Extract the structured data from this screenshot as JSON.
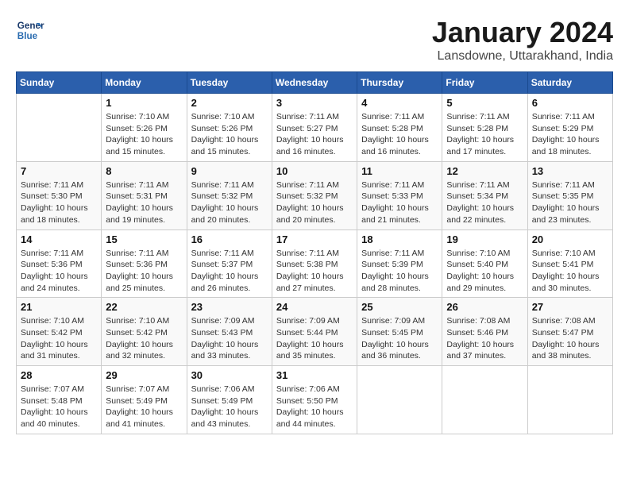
{
  "header": {
    "logo_line1": "General",
    "logo_line2": "Blue",
    "month": "January 2024",
    "location": "Lansdowne, Uttarakhand, India"
  },
  "weekdays": [
    "Sunday",
    "Monday",
    "Tuesday",
    "Wednesday",
    "Thursday",
    "Friday",
    "Saturday"
  ],
  "weeks": [
    [
      {
        "day": "",
        "info": ""
      },
      {
        "day": "1",
        "info": "Sunrise: 7:10 AM\nSunset: 5:26 PM\nDaylight: 10 hours\nand 15 minutes."
      },
      {
        "day": "2",
        "info": "Sunrise: 7:10 AM\nSunset: 5:26 PM\nDaylight: 10 hours\nand 15 minutes."
      },
      {
        "day": "3",
        "info": "Sunrise: 7:11 AM\nSunset: 5:27 PM\nDaylight: 10 hours\nand 16 minutes."
      },
      {
        "day": "4",
        "info": "Sunrise: 7:11 AM\nSunset: 5:28 PM\nDaylight: 10 hours\nand 16 minutes."
      },
      {
        "day": "5",
        "info": "Sunrise: 7:11 AM\nSunset: 5:28 PM\nDaylight: 10 hours\nand 17 minutes."
      },
      {
        "day": "6",
        "info": "Sunrise: 7:11 AM\nSunset: 5:29 PM\nDaylight: 10 hours\nand 18 minutes."
      }
    ],
    [
      {
        "day": "7",
        "info": "Sunrise: 7:11 AM\nSunset: 5:30 PM\nDaylight: 10 hours\nand 18 minutes."
      },
      {
        "day": "8",
        "info": "Sunrise: 7:11 AM\nSunset: 5:31 PM\nDaylight: 10 hours\nand 19 minutes."
      },
      {
        "day": "9",
        "info": "Sunrise: 7:11 AM\nSunset: 5:32 PM\nDaylight: 10 hours\nand 20 minutes."
      },
      {
        "day": "10",
        "info": "Sunrise: 7:11 AM\nSunset: 5:32 PM\nDaylight: 10 hours\nand 20 minutes."
      },
      {
        "day": "11",
        "info": "Sunrise: 7:11 AM\nSunset: 5:33 PM\nDaylight: 10 hours\nand 21 minutes."
      },
      {
        "day": "12",
        "info": "Sunrise: 7:11 AM\nSunset: 5:34 PM\nDaylight: 10 hours\nand 22 minutes."
      },
      {
        "day": "13",
        "info": "Sunrise: 7:11 AM\nSunset: 5:35 PM\nDaylight: 10 hours\nand 23 minutes."
      }
    ],
    [
      {
        "day": "14",
        "info": "Sunrise: 7:11 AM\nSunset: 5:36 PM\nDaylight: 10 hours\nand 24 minutes."
      },
      {
        "day": "15",
        "info": "Sunrise: 7:11 AM\nSunset: 5:36 PM\nDaylight: 10 hours\nand 25 minutes."
      },
      {
        "day": "16",
        "info": "Sunrise: 7:11 AM\nSunset: 5:37 PM\nDaylight: 10 hours\nand 26 minutes."
      },
      {
        "day": "17",
        "info": "Sunrise: 7:11 AM\nSunset: 5:38 PM\nDaylight: 10 hours\nand 27 minutes."
      },
      {
        "day": "18",
        "info": "Sunrise: 7:11 AM\nSunset: 5:39 PM\nDaylight: 10 hours\nand 28 minutes."
      },
      {
        "day": "19",
        "info": "Sunrise: 7:10 AM\nSunset: 5:40 PM\nDaylight: 10 hours\nand 29 minutes."
      },
      {
        "day": "20",
        "info": "Sunrise: 7:10 AM\nSunset: 5:41 PM\nDaylight: 10 hours\nand 30 minutes."
      }
    ],
    [
      {
        "day": "21",
        "info": "Sunrise: 7:10 AM\nSunset: 5:42 PM\nDaylight: 10 hours\nand 31 minutes."
      },
      {
        "day": "22",
        "info": "Sunrise: 7:10 AM\nSunset: 5:42 PM\nDaylight: 10 hours\nand 32 minutes."
      },
      {
        "day": "23",
        "info": "Sunrise: 7:09 AM\nSunset: 5:43 PM\nDaylight: 10 hours\nand 33 minutes."
      },
      {
        "day": "24",
        "info": "Sunrise: 7:09 AM\nSunset: 5:44 PM\nDaylight: 10 hours\nand 35 minutes."
      },
      {
        "day": "25",
        "info": "Sunrise: 7:09 AM\nSunset: 5:45 PM\nDaylight: 10 hours\nand 36 minutes."
      },
      {
        "day": "26",
        "info": "Sunrise: 7:08 AM\nSunset: 5:46 PM\nDaylight: 10 hours\nand 37 minutes."
      },
      {
        "day": "27",
        "info": "Sunrise: 7:08 AM\nSunset: 5:47 PM\nDaylight: 10 hours\nand 38 minutes."
      }
    ],
    [
      {
        "day": "28",
        "info": "Sunrise: 7:07 AM\nSunset: 5:48 PM\nDaylight: 10 hours\nand 40 minutes."
      },
      {
        "day": "29",
        "info": "Sunrise: 7:07 AM\nSunset: 5:49 PM\nDaylight: 10 hours\nand 41 minutes."
      },
      {
        "day": "30",
        "info": "Sunrise: 7:06 AM\nSunset: 5:49 PM\nDaylight: 10 hours\nand 43 minutes."
      },
      {
        "day": "31",
        "info": "Sunrise: 7:06 AM\nSunset: 5:50 PM\nDaylight: 10 hours\nand 44 minutes."
      },
      {
        "day": "",
        "info": ""
      },
      {
        "day": "",
        "info": ""
      },
      {
        "day": "",
        "info": ""
      }
    ]
  ]
}
